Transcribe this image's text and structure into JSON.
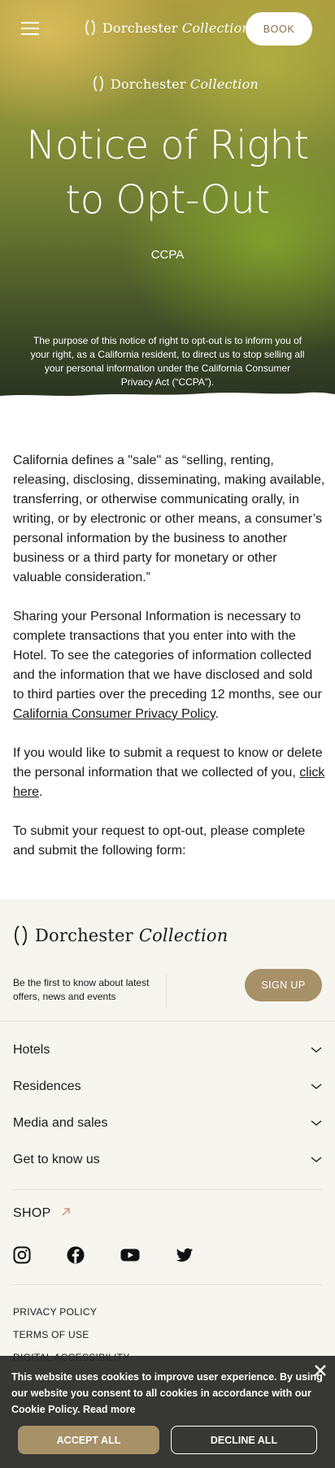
{
  "header": {
    "brand": "Dorchester",
    "brand_italic": "Collection",
    "book_label": "BOOK"
  },
  "hero": {
    "title_line1": "Notice of Right",
    "title_line2": "to Opt-Out",
    "subtitle": "CCPA",
    "description": "The purpose of this notice of right to opt-out is to inform you of your right, as a California resident, to direct us to stop selling all your personal information under the California Consumer Privacy Act (“CCPA”)."
  },
  "content": {
    "p1": "California defines a \"sale\" as “selling, renting, releasing, disclosing, disseminating, making available, transferring, or otherwise communicating orally, in writing, or by electronic or other means, a consumer’s personal information by the business to another business or a third party for monetary or other valuable consideration.”",
    "p2_text": "Sharing your Personal Information is necessary to complete transactions that you enter into with the Hotel. To see the categories of information collected and the information that we have disclosed and sold to third parties over the preceding 12 months, see our ",
    "p2_link": "California Consumer Privacy Policy",
    "p2_end": ".",
    "p3_text": "If you would like to submit a request to know or delete the personal information that we collected of you, ",
    "p3_link": "click here",
    "p3_end": ".",
    "p4": "To submit your request to opt-out, please complete and submit the following form:"
  },
  "footer": {
    "brand": "Dorchester",
    "brand_italic": "Collection",
    "newsletter_text": "Be the first to know about latest offers, news and events",
    "signup_label": "SIGN UP",
    "accordion": [
      "Hotels",
      "Residences",
      "Media and sales",
      "Get to know us"
    ],
    "shop_label": "SHOP",
    "socials": [
      "instagram-icon",
      "facebook-icon",
      "youtube-icon",
      "twitter-icon"
    ],
    "legal": [
      "PRIVACY POLICY",
      "TERMS OF USE",
      "DIGITAL ACCESSIBILITY"
    ]
  },
  "cookie": {
    "text": "This website uses cookies to improve user experience. By using our website you consent to all cookies in accordance with our Cookie Policy.",
    "read_more": "Read more",
    "accept_label": "ACCEPT ALL",
    "decline_label": "DECLINE ALL"
  },
  "colors": {
    "accent_gold": "#a79169",
    "book_text": "#8a6f4c",
    "footer_bg": "#f7f5ef",
    "cookie_bg": "#282828"
  }
}
